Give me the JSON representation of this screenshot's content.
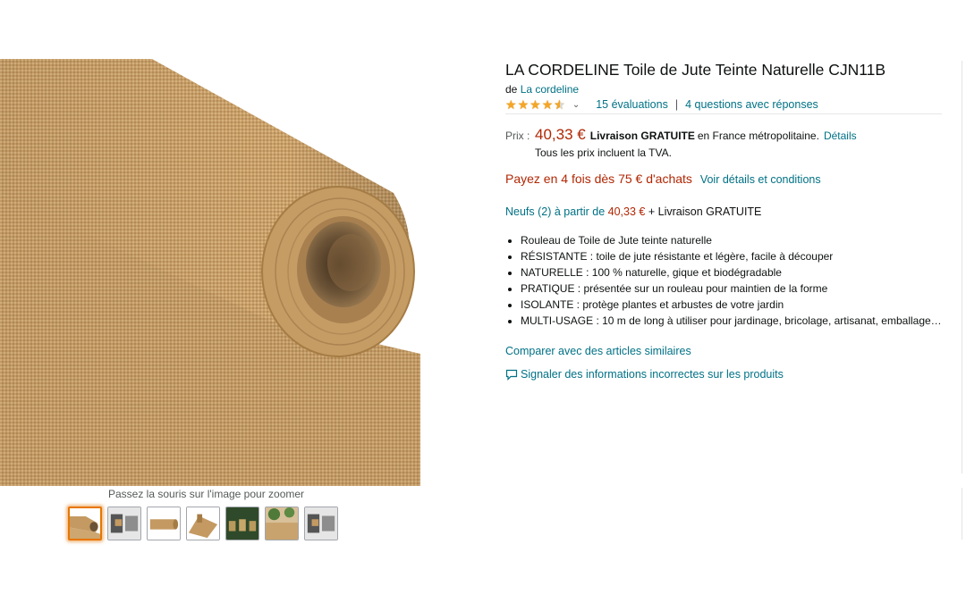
{
  "colors": {
    "link": "#007185",
    "price": "#b12704",
    "star": "#f5a623",
    "thumb_selected_border": "#e77600",
    "jute_light": "#d1ab73",
    "jute_dark": "#a57c44"
  },
  "gallery": {
    "zoom_hint": "Passez la souris sur l'image pour zoomer",
    "thumbnails": [
      {
        "icon": "jute-roll-thumbnail",
        "selected": true
      },
      {
        "icon": "jute-scene-thumbnail",
        "selected": false
      },
      {
        "icon": "jute-roll-side-thumbnail",
        "selected": false
      },
      {
        "icon": "jute-roll-flat-thumbnail",
        "selected": false
      },
      {
        "icon": "garden-pots-thumbnail",
        "selected": false
      },
      {
        "icon": "plants-wrapped-thumbnail",
        "selected": false
      },
      {
        "icon": "jute-scene-thumbnail",
        "selected": false
      }
    ]
  },
  "product": {
    "title": "LA CORDELINE Toile de Jute Teinte Naturelle CJN11B",
    "brand_prefix": "de",
    "brand": "La cordeline",
    "rating": 4.5,
    "ratings_link": "15 évaluations",
    "separator": "|",
    "questions_link": "4 questions avec réponses",
    "price_label": "Prix :",
    "price": "40,33 €",
    "free_shipping": "Livraison GRATUITE",
    "shipping_destination": "en France métropolitaine.",
    "shipping_details_link": "Détails",
    "tax_note": "Tous les prix incluent la TVA.",
    "installments_text": "Payez en 4 fois dès 75 € d'achats",
    "installments_link": "Voir détails et conditions",
    "offers_link": "Neufs (2) à partir de",
    "offers_price": "40,33 €",
    "offers_shipping": "+ Livraison GRATUITE",
    "bullets": [
      "Rouleau de Toile de Jute teinte naturelle",
      "RÉSISTANTE : toile de jute résistante et légère, facile à découper",
      "NATURELLE : 100 % naturelle, gique et biodégradable",
      "PRATIQUE : présentée sur un rouleau pour maintien de la forme",
      "ISOLANTE : protège plantes et arbustes de votre jardin",
      "MULTI-USAGE : 10 m de long à utiliser pour jardinage, bricolage, artisanat, emballage…"
    ],
    "compare_link": "Comparer avec des articles similaires",
    "report_link": "Signaler des informations incorrectes sur les produits"
  }
}
